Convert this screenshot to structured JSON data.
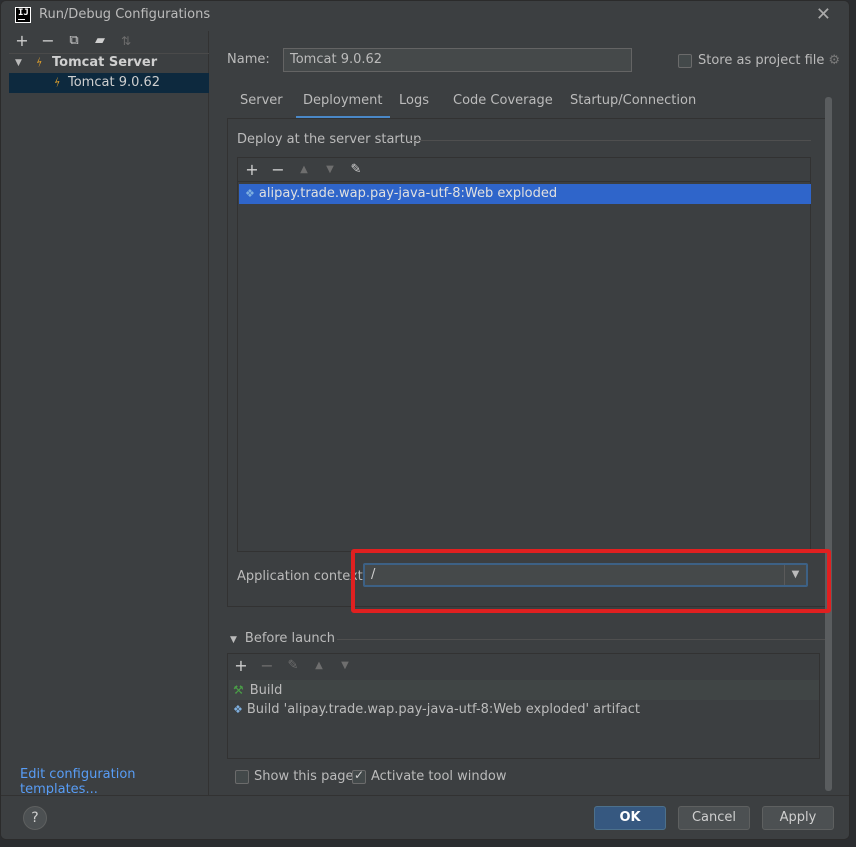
{
  "window": {
    "title": "Run/Debug Configurations",
    "close_icon": "close-icon"
  },
  "sidebar": {
    "toolbar": [
      "add-icon",
      "remove-icon",
      "copy-icon",
      "folder-icon",
      "sort-icon"
    ],
    "tree": {
      "group_label": "Tomcat Server",
      "child_label": "Tomcat 9.0.62"
    },
    "edit_templates_link": "Edit configuration templates..."
  },
  "config": {
    "name_label": "Name:",
    "name_value": "Tomcat 9.0.62",
    "store_label": "Store as project file",
    "store_checked": false
  },
  "tabs": [
    {
      "label": "Server",
      "active": false
    },
    {
      "label": "Deployment",
      "active": true
    },
    {
      "label": "Logs",
      "active": false
    },
    {
      "label": "Code Coverage",
      "active": false
    },
    {
      "label": "Startup/Connection",
      "active": false
    }
  ],
  "deployment": {
    "section_title": "Deploy at the server startup",
    "artifacts": [
      "alipay.trade.wap.pay-java-utf-8:Web exploded"
    ],
    "context_label": "Application context:",
    "context_value": "/"
  },
  "before_launch": {
    "title": "Before launch",
    "items": [
      {
        "label": "Build",
        "icon": "hammer-icon"
      },
      {
        "label": "Build 'alipay.trade.wap.pay-java-utf-8:Web exploded' artifact",
        "icon": "artifact-icon"
      }
    ]
  },
  "options": {
    "show_page_label": "Show this page",
    "show_page_checked": false,
    "activate_label": "Activate tool window",
    "activate_checked": true
  },
  "buttons": {
    "help": "?",
    "ok": "OK",
    "cancel": "Cancel",
    "apply": "Apply"
  },
  "colors": {
    "accent": "#365880",
    "selection": "#2f65ca",
    "highlight": "#e02020",
    "link": "#589df6"
  }
}
